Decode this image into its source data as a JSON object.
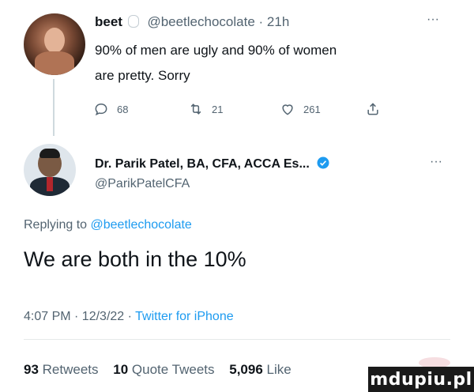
{
  "tweet1": {
    "display_name": "beet",
    "handle": "@beetlechocolate",
    "time": "· 21h",
    "text_line1": "90% of men are ugly and 90% of women",
    "text_line2": "are pretty. Sorry",
    "more_label": "···",
    "reply_count": "68",
    "retweet_count": "21",
    "like_count": "261"
  },
  "tweet2": {
    "display_name": "Dr. Parik Patel, BA, CFA, ACCA Es...",
    "handle": "@ParikPatelCFA",
    "more_label": "···",
    "replying_prefix": "Replying to",
    "replying_handle": "@beetlechocolate",
    "text": "We are both in the 10%",
    "timestamp": "4:07 PM · 12/3/22 ·",
    "source": "Twitter for iPhone",
    "stats": [
      {
        "count": "93",
        "label": "Retweets"
      },
      {
        "count": "10",
        "label": "Quote Tweets"
      },
      {
        "count": "5,096",
        "label": "Like"
      }
    ]
  },
  "watermark": "mdupiu.pl",
  "colors": {
    "link": "#1d9bf0",
    "muted": "#536471",
    "text": "#0f1419",
    "verified": "#1d9bf0"
  },
  "icons": [
    "reply-icon",
    "retweet-icon",
    "like-icon",
    "share-icon",
    "verified-badge-icon",
    "more-icon"
  ]
}
